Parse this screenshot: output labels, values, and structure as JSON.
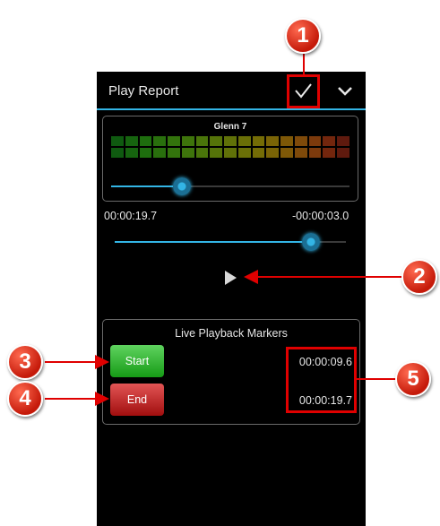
{
  "action_bar": {
    "title": "Play Report",
    "confirm_icon": "check-icon",
    "menu_icon": "chevron-down-icon",
    "accent": "#33b5e5"
  },
  "meter": {
    "label": "Glenn 7",
    "level_fraction": 0.26,
    "bar_colors": [
      "#0f5a10",
      "#16640f",
      "#1e6e0e",
      "#296f0d",
      "#33730c",
      "#3e740b",
      "#4a750a",
      "#557309",
      "#607108",
      "#6a6f07",
      "#746c06",
      "#7a6406",
      "#7e5807",
      "#7f4a0a",
      "#7c3a0c",
      "#73260d",
      "#5f1a0e"
    ]
  },
  "playback": {
    "elapsed": "00:00:19.7",
    "remaining": "-00:00:03.0",
    "position_fraction": 0.85,
    "play_icon": "play-icon"
  },
  "markers": {
    "title": "Live Playback Markers",
    "start_label": "Start",
    "end_label": "End",
    "start_time": "00:00:09.6",
    "end_time": "00:00:19.7"
  },
  "callouts": [
    "1",
    "2",
    "3",
    "4",
    "5"
  ]
}
